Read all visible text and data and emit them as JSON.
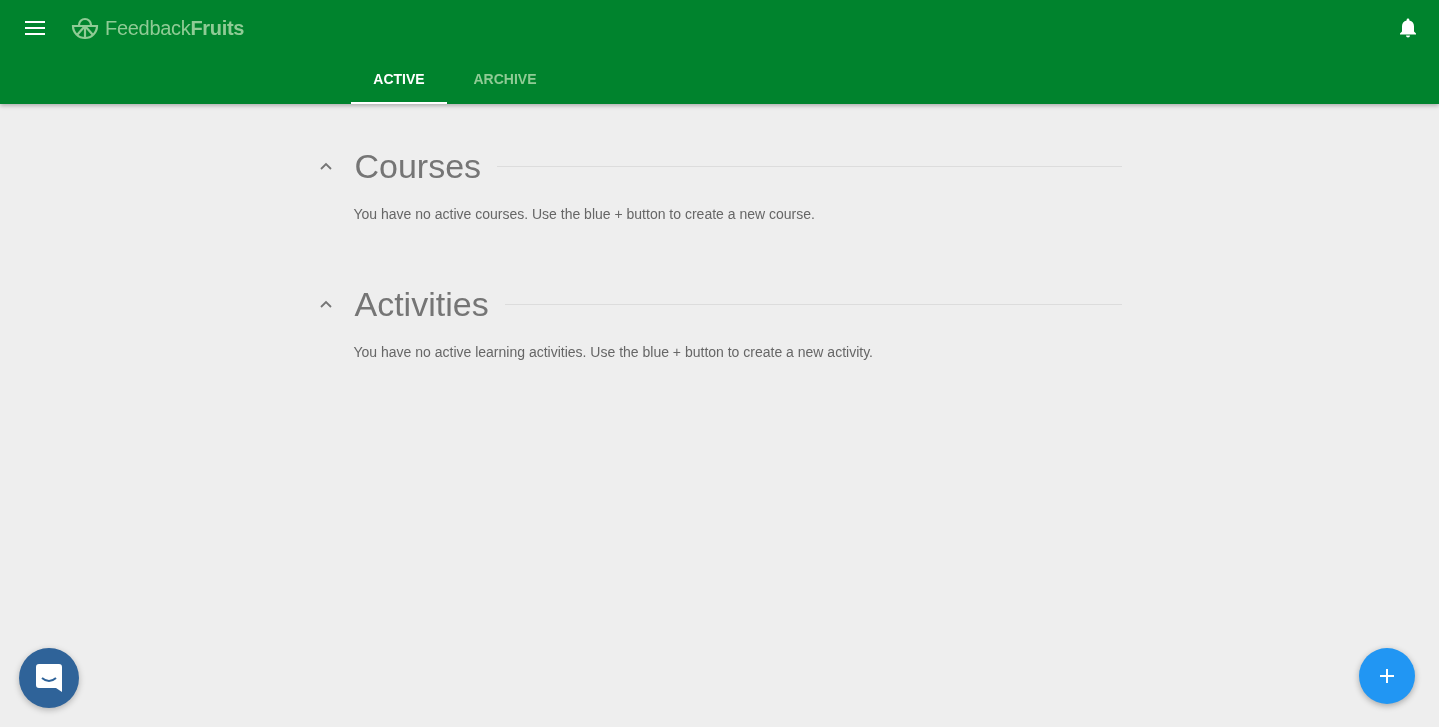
{
  "header": {
    "logo": "Feedback**Fruits**"
  },
  "tabs": [
    {
      "label": "ACTIVE",
      "selected": true
    },
    {
      "label": "ARCHIVE",
      "selected": false
    }
  ],
  "sections": [
    {
      "title": "Courses",
      "expanded": true,
      "message": "You have no active courses. Use the blue + button to create a new course."
    },
    {
      "title": "Activities",
      "expanded": true,
      "message": "You have no active learning activities. Use the blue + button to create a new activity."
    }
  ]
}
